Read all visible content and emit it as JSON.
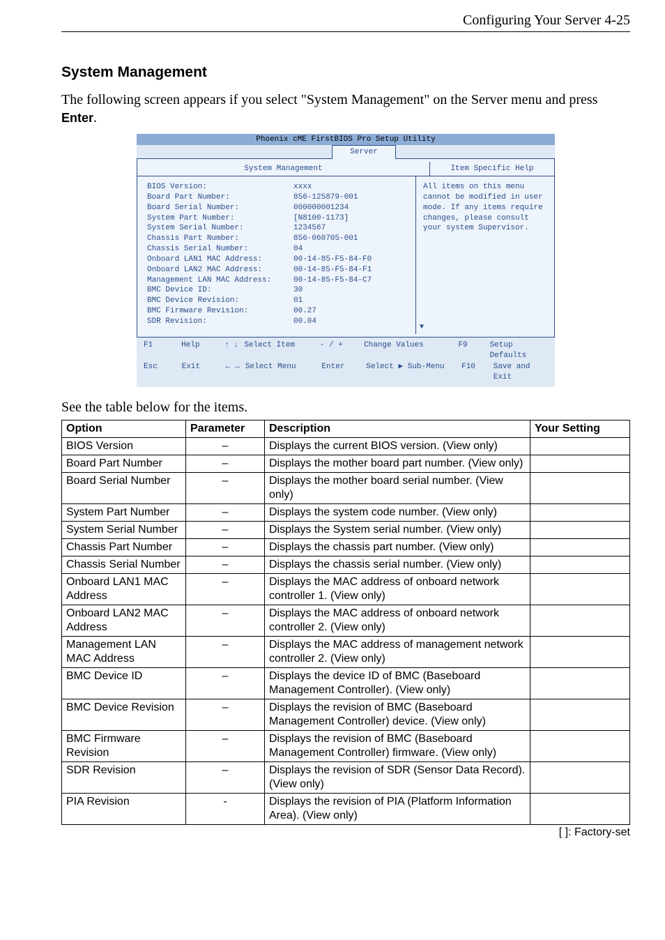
{
  "header": {
    "text": "Configuring Your Server   4-25"
  },
  "section": {
    "title": "System Management",
    "intro_pre": "The following screen appears if you select \"System Management\" on the Server menu and press ",
    "intro_bold": "Enter",
    "intro_post": "."
  },
  "bios": {
    "title": "Phoenix cME FirstBIOS Pro Setup Utility",
    "tab": "Server",
    "sub_left": "System Management",
    "sub_right": "Item Specific Help",
    "rows": [
      {
        "k": "BIOS Version:",
        "v": "xxxx"
      },
      {
        "k": "",
        "v": ""
      },
      {
        "k": "Board Part Number:",
        "v": "856-125879-001"
      },
      {
        "k": "Board Serial Number:",
        "v": "000000001234"
      },
      {
        "k": "System Part Number:",
        "v": "[N8100-1173]"
      },
      {
        "k": "System Serial Number:",
        "v": "1234567"
      },
      {
        "k": "Chassis Part Number:",
        "v": "856-060705-001"
      },
      {
        "k": "Chassis Serial Number:",
        "v": "04"
      },
      {
        "k": "Onboard LAN1 MAC Address:",
        "v": "00-14-85-F5-84-F0"
      },
      {
        "k": "Onboard LAN2 MAC Address:",
        "v": "00-14-85-F5-84-F1"
      },
      {
        "k": "Management LAN MAC Address:",
        "v": "00-14-85-F5-84-C7"
      },
      {
        "k": "BMC Device ID:",
        "v": "30"
      },
      {
        "k": "BMC Device Revision:",
        "v": "01"
      },
      {
        "k": "BMC Firmware Revision:",
        "v": "00.27"
      },
      {
        "k": "SDR Revision:",
        "v": "00.04"
      }
    ],
    "help_text": "All items on this menu cannot be modified in user mode. If any items require changes, please consult your system Supervisor.",
    "footer": {
      "r1": {
        "c1": "F1",
        "c2": "Help",
        "c3": "↑ ↓",
        "c4": "Select Item",
        "c5": "- / +",
        "c6": "Change Values",
        "c7": "F9",
        "c8": "Setup Defaults"
      },
      "r2": {
        "c1": "Esc",
        "c2": "Exit",
        "c3": "← →",
        "c4": "Select Menu",
        "c5": "Enter",
        "c6": "Select ▶ Sub-Menu",
        "c7": "F10",
        "c8": "Save and Exit"
      }
    }
  },
  "caption": "See the table below for the items.",
  "table": {
    "headers": {
      "opt": "Option",
      "param": "Parameter",
      "desc": "Description",
      "set": "Your Setting"
    },
    "rows": [
      {
        "opt": "BIOS Version",
        "param": "–",
        "desc": "Displays the current BIOS version. (View only)",
        "set": ""
      },
      {
        "opt": "Board Part Number",
        "param": "–",
        "desc": "Displays the mother board part number. (View only)",
        "set": ""
      },
      {
        "opt": "Board Serial Number",
        "param": "–",
        "desc": "Displays the mother board serial number. (View only)",
        "set": ""
      },
      {
        "opt": "System Part Number",
        "param": "–",
        "desc": "Displays the system code number. (View only)",
        "set": ""
      },
      {
        "opt": "System Serial Number",
        "param": "–",
        "desc": "Displays the System serial number. (View only)",
        "set": ""
      },
      {
        "opt": "Chassis Part Number",
        "param": "–",
        "desc": "Displays the chassis part number. (View only)",
        "set": ""
      },
      {
        "opt": "Chassis Serial Number",
        "param": "–",
        "desc": "Displays the chassis serial number. (View only)",
        "set": ""
      },
      {
        "opt": "Onboard LAN1 MAC Address",
        "param": "–",
        "desc": "Displays the MAC address of onboard network controller 1. (View only)",
        "set": ""
      },
      {
        "opt": "Onboard LAN2 MAC Address",
        "param": "–",
        "desc": "Displays the MAC address of onboard network controller 2. (View only)",
        "set": ""
      },
      {
        "opt": "Management LAN MAC Address",
        "param": "–",
        "desc": "Displays the MAC address of management network controller 2. (View only)",
        "set": ""
      },
      {
        "opt": "BMC Device ID",
        "param": "–",
        "desc": "Displays the device ID of BMC (Baseboard Management Controller). (View only)",
        "set": ""
      },
      {
        "opt": "BMC Device Revision",
        "param": "–",
        "desc": "Displays the revision of BMC (Baseboard Management Controller) device. (View only)",
        "set": ""
      },
      {
        "opt": "BMC Firmware Revision",
        "param": "–",
        "desc": "Displays the revision of BMC (Baseboard Management Controller) firmware. (View only)",
        "set": ""
      },
      {
        "opt": "SDR Revision",
        "param": "–",
        "desc": "Displays the revision of SDR (Sensor Data Record). (View only)",
        "set": ""
      },
      {
        "opt": "PIA Revision",
        "param": "-",
        "desc": "Displays the revision of PIA (Platform Information Area). (View only)",
        "set": ""
      }
    ]
  },
  "factory": "[     ]: Factory-set"
}
